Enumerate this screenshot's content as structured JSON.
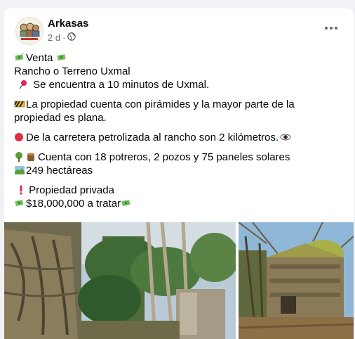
{
  "post": {
    "author": "Arkasas",
    "time": "2 d",
    "lines": [
      "Venta",
      "Rancho o Terreno Uxmal",
      " Se encuentra a 10 minutos de Uxmal.",
      "La propiedad cuenta con pirámides y la mayor parte de la",
      "propiedad es plana.",
      "De la carretera petrolizada al rancho son 2 kilómetros.",
      "Cuenta con 18 potreros, 2 pozos y 75 paneles solares",
      "249 hectáreas",
      " Propiedad privada",
      "$18,000,000 a tratar"
    ]
  },
  "icons": {
    "privacy": "globe-icon",
    "more": "more-options-icon",
    "money": "money-with-wings-icon",
    "pin": "round-pushpin-icon",
    "construction": "construction-icon",
    "red_circle": "red-circle-icon",
    "tree": "deciduous-tree-icon",
    "wood": "wood-icon",
    "landscape": "national-park-icon",
    "exclamation": "red-exclamation-icon",
    "eye": "eye-icon"
  },
  "photos": [
    {
      "name": "ruins-photo-1"
    },
    {
      "name": "ruins-photo-2"
    }
  ]
}
